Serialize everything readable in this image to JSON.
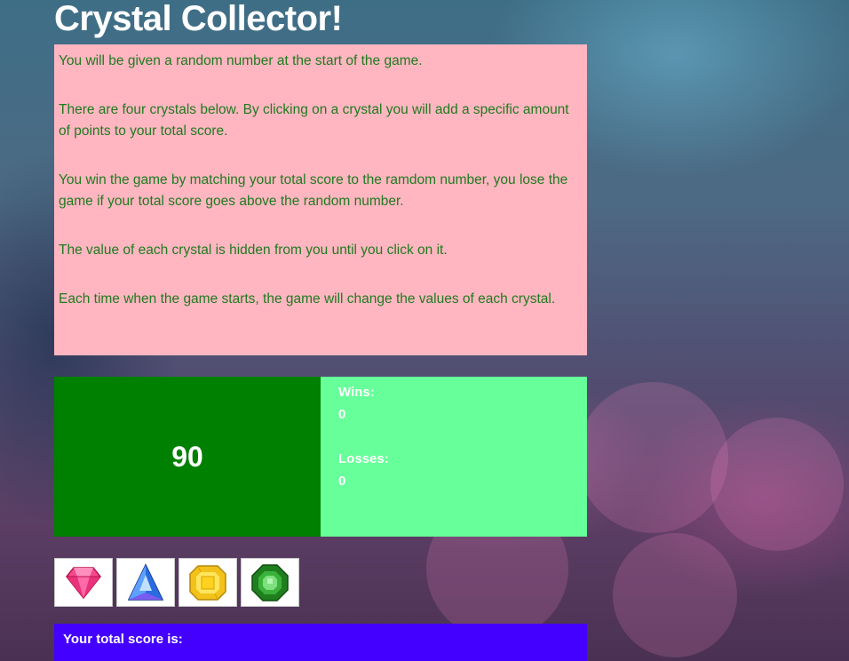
{
  "title": "Crystal Collector!",
  "instructions": [
    "You will be given a random number at the start of the game.",
    "There are four crystals below. By clicking on a crystal you will add a specific amount of points to your total score.",
    "You win the game by matching your total score to the ramdom number, you lose the game if your total score goes above the random number.",
    "The value of each crystal is hidden from you until you click on it.",
    "Each time when the game starts, the game will change the values of each crystal."
  ],
  "target_number": "90",
  "stats": {
    "wins_label": "Wins:",
    "wins_value": "0",
    "losses_label": "Losses:",
    "losses_value": "0"
  },
  "crystals": [
    {
      "name": "pink-crystal-icon",
      "color": "#e8327a"
    },
    {
      "name": "blue-crystal-icon",
      "color": "#2f6bd8"
    },
    {
      "name": "yellow-crystal-icon",
      "color": "#f2c21b"
    },
    {
      "name": "green-crystal-icon",
      "color": "#2e9e2a"
    }
  ],
  "total_score_label": "Your total score is:",
  "colors": {
    "instructions_bg": "#ffb6c1",
    "instructions_text": "#1f7a1f",
    "target_bg": "#008000",
    "stats_bg": "#66ff99",
    "total_bg": "#4400ff"
  }
}
